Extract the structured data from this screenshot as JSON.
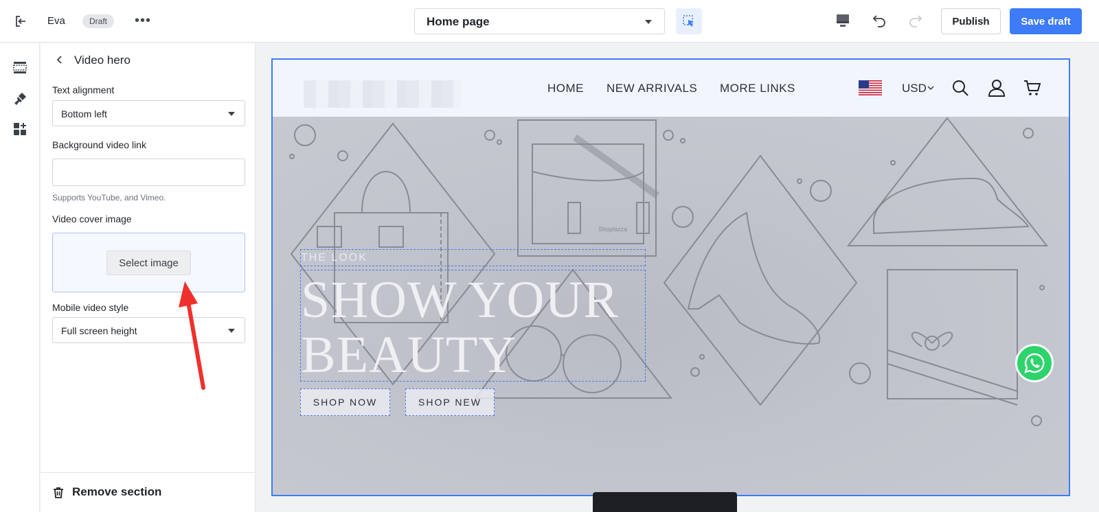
{
  "topbar": {
    "store_name": "Eva",
    "status_badge": "Draft",
    "more_label": "•••",
    "page_selector": "Home page",
    "publish_label": "Publish",
    "save_label": "Save draft"
  },
  "panel": {
    "title": "Video hero",
    "fields": {
      "text_alignment": {
        "label": "Text alignment",
        "value": "Bottom left"
      },
      "background_video": {
        "label": "Background video link",
        "value": "",
        "placeholder": "",
        "help": "Supports YouTube, and Vimeo."
      },
      "cover_image": {
        "label": "Video cover image",
        "button": "Select image"
      },
      "mobile_style": {
        "label": "Mobile video style",
        "value": "Full screen height"
      }
    },
    "footer": {
      "remove_label": "Remove section"
    }
  },
  "preview": {
    "nav": [
      "HOME",
      "NEW ARRIVALS",
      "MORE LINKS"
    ],
    "currency": "USD",
    "hero": {
      "subtitle": "THE LOOK",
      "title": "SHOW YOUR BEAUTY",
      "buttons": [
        "SHOP NOW",
        "SHOP NEW"
      ],
      "watermark": "Shoplazza"
    }
  },
  "colors": {
    "accent": "#3d7bf7",
    "hero_bg": "#c4c6cf",
    "whatsapp": "#2cd46b",
    "annotation": "#f0302c"
  },
  "icons": [
    "exit-icon",
    "pointer-select-icon",
    "desktop-icon",
    "undo-icon",
    "redo-icon",
    "sections-icon",
    "theme-brush-icon",
    "add-block-icon",
    "back-chevron-icon",
    "trash-icon",
    "us-flag-icon",
    "search-icon",
    "account-icon",
    "cart-icon",
    "whatsapp-icon"
  ]
}
